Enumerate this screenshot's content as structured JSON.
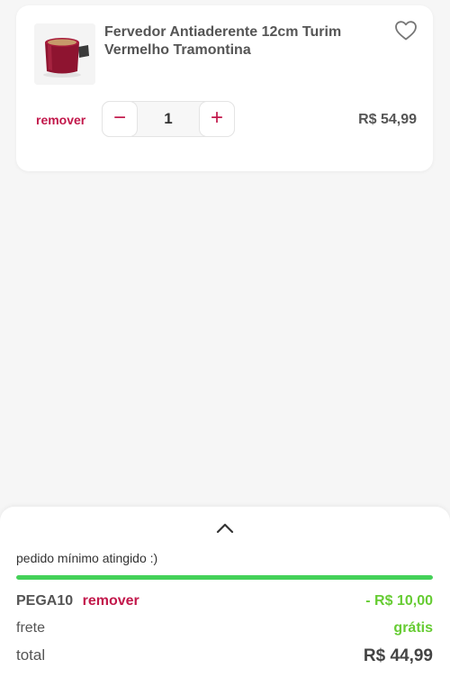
{
  "colors": {
    "accent": "#c2184b",
    "success": "#66cc33",
    "progress": "#44d158",
    "text": "#555555"
  },
  "cart_item": {
    "title": "Fervedor Antiaderente 12cm Turim Vermelho Tramontina",
    "image_icon": "red-milk-pot-image",
    "favorite_icon": "heart-outline-icon",
    "remove_label": "remover",
    "quantity": "1",
    "decrement_label": "−",
    "increment_label": "+",
    "price": "R$ 54,99"
  },
  "summary": {
    "toggle_icon": "chevron-up-icon",
    "min_order_text": "pedido mínimo atingido :)",
    "min_order_progress": 1.0,
    "coupon_code": "PEGA10",
    "coupon_remove_label": "remover",
    "discount": "- R$ 10,00",
    "shipping_label": "frete",
    "shipping_value": "grátis",
    "total_label": "total",
    "total_value": "R$ 44,99"
  }
}
